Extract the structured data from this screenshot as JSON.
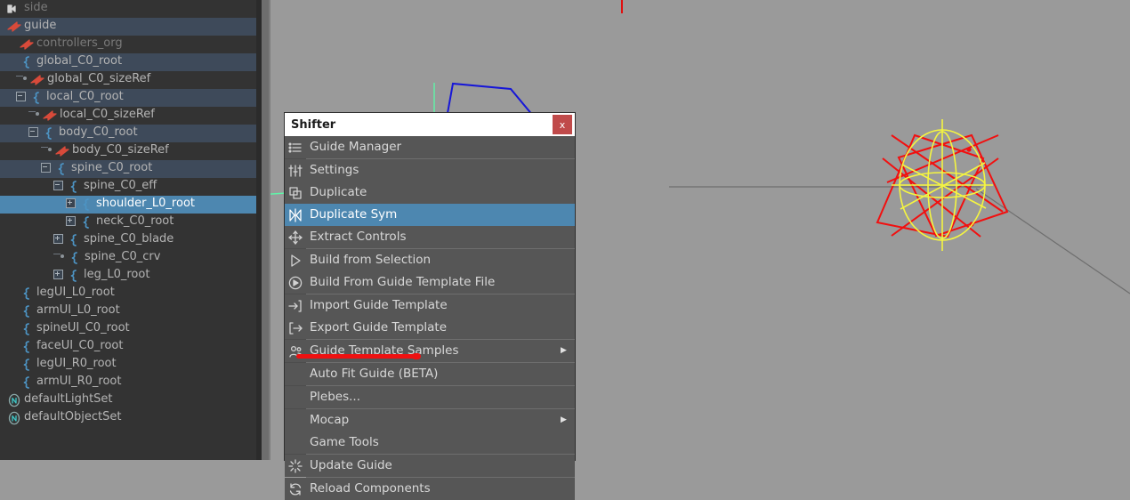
{
  "outliner": {
    "scroll_position": "top",
    "rows": [
      {
        "label": "side",
        "icon": "camera-icon",
        "indent": 0,
        "style": "dim",
        "toggle": "none",
        "band": "dark"
      },
      {
        "label": "guide",
        "icon": "transform-arrow-icon",
        "indent": 0,
        "style": "normal",
        "toggle": "none",
        "band": "alt"
      },
      {
        "label": "controllers_org",
        "icon": "transform-arrow-icon",
        "indent": 1,
        "style": "dim",
        "toggle": "none",
        "band": "dark"
      },
      {
        "label": "global_C0_root",
        "icon": "curve-icon",
        "indent": 1,
        "style": "normal",
        "toggle": "none",
        "band": "alt"
      },
      {
        "label": "global_C0_sizeRef",
        "icon": "transform-arrow-icon",
        "indent": 1,
        "style": "normal",
        "toggle": "leaf",
        "band": "dark"
      },
      {
        "label": "local_C0_root",
        "icon": "curve-icon",
        "indent": 1,
        "style": "normal",
        "toggle": "minus",
        "band": "alt"
      },
      {
        "label": "local_C0_sizeRef",
        "icon": "transform-arrow-icon",
        "indent": 2,
        "style": "normal",
        "toggle": "leaf",
        "band": "dark"
      },
      {
        "label": "body_C0_root",
        "icon": "curve-icon",
        "indent": 2,
        "style": "normal",
        "toggle": "minus",
        "band": "alt"
      },
      {
        "label": "body_C0_sizeRef",
        "icon": "transform-arrow-icon",
        "indent": 3,
        "style": "normal",
        "toggle": "leaf",
        "band": "dark"
      },
      {
        "label": "spine_C0_root",
        "icon": "curve-icon",
        "indent": 3,
        "style": "normal",
        "toggle": "minus",
        "band": "alt"
      },
      {
        "label": "spine_C0_eff",
        "icon": "curve-icon",
        "indent": 4,
        "style": "normal",
        "toggle": "minus",
        "band": "dark"
      },
      {
        "label": "shoulder_L0_root",
        "icon": "curve-icon",
        "indent": 5,
        "style": "normal",
        "toggle": "plus",
        "band": "sel"
      },
      {
        "label": "neck_C0_root",
        "icon": "curve-icon",
        "indent": 5,
        "style": "normal",
        "toggle": "plus",
        "band": "dark"
      },
      {
        "label": "spine_C0_blade",
        "icon": "curve-icon",
        "indent": 4,
        "style": "normal",
        "toggle": "plus",
        "band": "dark"
      },
      {
        "label": "spine_C0_crv",
        "icon": "curve-icon",
        "indent": 4,
        "style": "normal",
        "toggle": "leaf",
        "band": "dark"
      },
      {
        "label": "leg_L0_root",
        "icon": "curve-icon",
        "indent": 4,
        "style": "normal",
        "toggle": "plus",
        "band": "dark"
      },
      {
        "label": "legUI_L0_root",
        "icon": "curve-icon",
        "indent": 1,
        "style": "normal",
        "toggle": "none",
        "band": "dark"
      },
      {
        "label": "armUI_L0_root",
        "icon": "curve-icon",
        "indent": 1,
        "style": "normal",
        "toggle": "none",
        "band": "dark"
      },
      {
        "label": "spineUI_C0_root",
        "icon": "curve-icon",
        "indent": 1,
        "style": "normal",
        "toggle": "none",
        "band": "dark"
      },
      {
        "label": "faceUI_C0_root",
        "icon": "curve-icon",
        "indent": 1,
        "style": "normal",
        "toggle": "none",
        "band": "dark"
      },
      {
        "label": "legUI_R0_root",
        "icon": "curve-icon",
        "indent": 1,
        "style": "normal",
        "toggle": "none",
        "band": "dark"
      },
      {
        "label": "armUI_R0_root",
        "icon": "curve-icon",
        "indent": 1,
        "style": "normal",
        "toggle": "none",
        "band": "dark"
      },
      {
        "label": "defaultLightSet",
        "icon": "set-node-icon",
        "indent": 0,
        "style": "normal",
        "toggle": "none",
        "band": "dark"
      },
      {
        "label": "defaultObjectSet",
        "icon": "set-node-icon",
        "indent": 0,
        "style": "normal",
        "toggle": "none",
        "band": "dark"
      }
    ]
  },
  "menu": {
    "title": "Shifter",
    "close_label": "x",
    "highlight_color": "#4d87b0",
    "annotation": {
      "type": "red-strikethrough",
      "over_item": "Extract Controls",
      "color": "#ee1111"
    },
    "items": [
      {
        "label": "Guide Manager",
        "icon": "list-icon",
        "submenu": false,
        "highlighted": false,
        "sep_after": true
      },
      {
        "label": "Settings",
        "icon": "sliders-icon",
        "submenu": false,
        "highlighted": false,
        "sep_after": false
      },
      {
        "label": "Duplicate",
        "icon": "copy-icon",
        "submenu": false,
        "highlighted": false,
        "sep_after": false
      },
      {
        "label": "Duplicate Sym",
        "icon": "mirror-icon",
        "submenu": false,
        "highlighted": true,
        "sep_after": false
      },
      {
        "label": "Extract Controls",
        "icon": "move-icon",
        "submenu": false,
        "highlighted": false,
        "sep_after": true
      },
      {
        "label": "Build from Selection",
        "icon": "play-outline-icon",
        "submenu": false,
        "highlighted": false,
        "sep_after": false
      },
      {
        "label": "Build From Guide Template File",
        "icon": "play-circle-icon",
        "submenu": false,
        "highlighted": false,
        "sep_after": true
      },
      {
        "label": "Import Guide Template",
        "icon": "import-arrow-icon",
        "submenu": false,
        "highlighted": false,
        "sep_after": false
      },
      {
        "label": "Export Guide Template",
        "icon": "export-arrow-icon",
        "submenu": false,
        "highlighted": false,
        "sep_after": true
      },
      {
        "label": "Guide Template Samples",
        "icon": "people-icon",
        "submenu": true,
        "highlighted": false,
        "sep_after": true
      },
      {
        "label": "Auto Fit Guide (BETA)",
        "icon": "none",
        "submenu": false,
        "highlighted": false,
        "sep_after": true
      },
      {
        "label": "Plebes...",
        "icon": "none",
        "submenu": false,
        "highlighted": false,
        "sep_after": true
      },
      {
        "label": "Mocap",
        "icon": "none",
        "submenu": true,
        "highlighted": false,
        "sep_after": false
      },
      {
        "label": "Game Tools",
        "icon": "none",
        "submenu": false,
        "highlighted": false,
        "sep_after": true
      },
      {
        "label": "Update Guide",
        "icon": "refresh-star-icon",
        "submenu": false,
        "highlighted": false,
        "sep_after": true
      },
      {
        "label": "Reload Components",
        "icon": "reload-icon",
        "submenu": false,
        "highlighted": false,
        "sep_after": false
      }
    ]
  },
  "viewport": {
    "background_color": "#9a9a9a",
    "objects": [
      {
        "name": "guide-cube-wireframe",
        "color": "#5ff5a8"
      },
      {
        "name": "shoulder-guide-polyline",
        "color": "#1616d8"
      },
      {
        "name": "global-control-diamond",
        "color": "#f20f0f"
      },
      {
        "name": "global-control-sphere",
        "color": "#f5f540"
      },
      {
        "name": "connection-line",
        "color": "#6e6e6e"
      },
      {
        "name": "red-marker-top",
        "color": "#e01010"
      }
    ]
  }
}
